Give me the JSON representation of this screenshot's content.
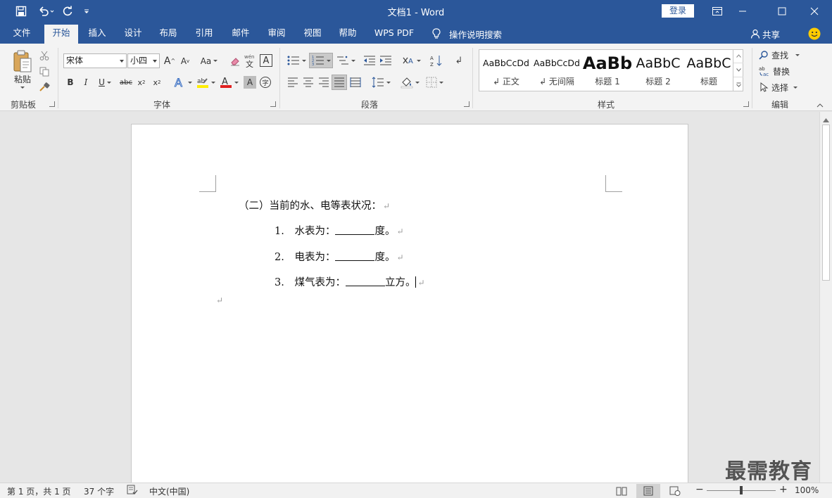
{
  "title_bar": {
    "title": "文档1  -  Word",
    "login_label": "登录"
  },
  "tabs": [
    {
      "label": "文件",
      "active": false
    },
    {
      "label": "开始",
      "active": true
    },
    {
      "label": "插入",
      "active": false
    },
    {
      "label": "设计",
      "active": false
    },
    {
      "label": "布局",
      "active": false
    },
    {
      "label": "引用",
      "active": false
    },
    {
      "label": "邮件",
      "active": false
    },
    {
      "label": "审阅",
      "active": false
    },
    {
      "label": "视图",
      "active": false
    },
    {
      "label": "帮助",
      "active": false
    },
    {
      "label": "WPS PDF",
      "active": false
    }
  ],
  "tell_me": "操作说明搜索",
  "share": "共享",
  "ribbon": {
    "clipboard": {
      "paste_label": "粘贴",
      "group_label": "剪贴板"
    },
    "font": {
      "font_name": "宋体",
      "font_size": "小四",
      "case_label": "Aa",
      "group_label": "字体"
    },
    "paragraph": {
      "group_label": "段落"
    },
    "styles": {
      "group_label": "样式",
      "items": [
        {
          "sample": "AaBbCcDd",
          "name": "↲ 正文"
        },
        {
          "sample": "AaBbCcDd",
          "name": "↲ 无间隔"
        },
        {
          "sample": "AaBb",
          "name": "标题 1"
        },
        {
          "sample": "AaBbC",
          "name": "标题 2"
        },
        {
          "sample": "AaBbC",
          "name": "标题"
        }
      ]
    },
    "editing": {
      "find_label": "查找",
      "replace_label": "替换",
      "select_label": "选择",
      "group_label": "编辑"
    }
  },
  "document": {
    "heading": "（二）当前的水、电等表状况：",
    "list": [
      {
        "num": "1.",
        "text_before": "水表为：",
        "text_after": "度。"
      },
      {
        "num": "2.",
        "text_before": "电表为：",
        "text_after": "度。"
      },
      {
        "num": "3.",
        "text_before": "煤气表为：",
        "text_after": "立方。"
      }
    ],
    "para_mark": "↵"
  },
  "status_bar": {
    "page_info": "第 1 页，共 1 页",
    "word_count": "37 个字",
    "language": "中文(中国)",
    "zoom_level": "100%",
    "zoom_minus": "−",
    "zoom_plus": "+"
  },
  "watermark": "最需教育",
  "colors": {
    "brand": "#2b579a",
    "ribbon_bg": "#f3f3f3",
    "doc_bg": "#e6e6e6",
    "font_color_red": "#e02020",
    "highlight_yellow": "#ffee00"
  }
}
